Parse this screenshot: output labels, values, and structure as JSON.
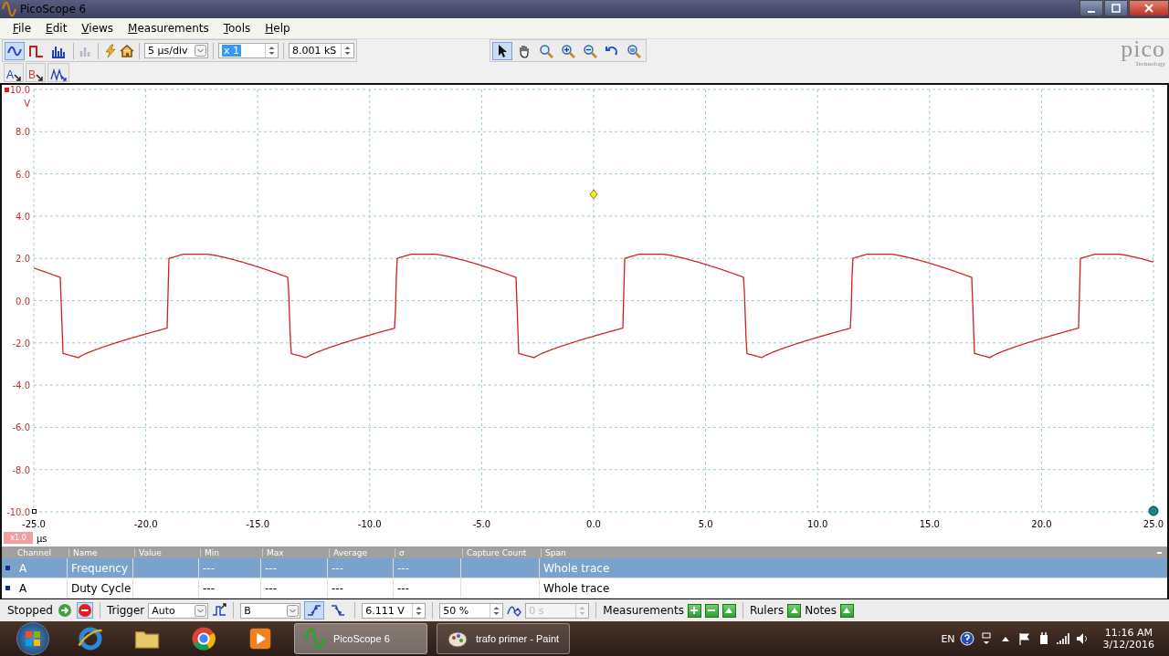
{
  "window": {
    "title": "PicoScope 6"
  },
  "menu": [
    "File",
    "Edit",
    "Views",
    "Measurements",
    "Tools",
    "Help"
  ],
  "modes": [
    {
      "kind": "scope",
      "selected": true
    },
    {
      "kind": "persistence",
      "selected": false
    },
    {
      "kind": "spectrum",
      "selected": false
    }
  ],
  "timebase": "5 µs/div",
  "zoom_field": "x 1",
  "samples": "8.001 kS",
  "tools": [
    {
      "kind": "pointer",
      "selected": true
    },
    {
      "kind": "hand",
      "selected": false
    },
    {
      "kind": "zoom-area",
      "selected": false
    },
    {
      "kind": "zoom-in",
      "selected": false
    },
    {
      "kind": "zoom-out",
      "selected": false
    },
    {
      "kind": "undo",
      "selected": false
    },
    {
      "kind": "zoom-overview",
      "selected": false
    }
  ],
  "logo": {
    "name": "pico",
    "tagline": "Technology"
  },
  "channels": [
    {
      "label": "A",
      "color": "#2040c0"
    },
    {
      "label": "B",
      "color": "#d04040"
    }
  ],
  "y_axis": {
    "unit": "V",
    "ticks": [
      "10.0",
      "8.0",
      "6.0",
      "4.0",
      "2.0",
      "0.0",
      "-2.0",
      "-4.0",
      "-6.0",
      "-8.0",
      "-10.0"
    ]
  },
  "x_axis": {
    "unit": "µs",
    "scale": "x1.0",
    "ticks": [
      "-25.0",
      "-20.0",
      "-15.0",
      "-10.0",
      "-5.0",
      "0.0",
      "5.0",
      "10.0",
      "15.0",
      "20.0",
      "25.0"
    ]
  },
  "table": {
    "columns": [
      "Channel",
      "Name",
      "Value",
      "Min",
      "Max",
      "Average",
      "σ",
      "Capture Count",
      "Span"
    ],
    "rows": [
      {
        "selected": true,
        "cells": [
          "A",
          "Frequency",
          "",
          "---",
          "---",
          "---",
          "---",
          "",
          "Whole trace"
        ]
      },
      {
        "selected": false,
        "cells": [
          "A",
          "Duty Cycle",
          "",
          "---",
          "---",
          "---",
          "---",
          "",
          "Whole trace"
        ]
      }
    ]
  },
  "status": {
    "state": "Stopped",
    "trigger_label": "Trigger",
    "trigger_mode": "Auto",
    "source": "B",
    "level": "6.111 V",
    "pretrigger": "50 %",
    "delay": {
      "value": "0 s",
      "disabled": true
    },
    "measurements": "Measurements",
    "rulers": "Rulers",
    "notes": "Notes"
  },
  "taskbar": {
    "tasks": [
      {
        "label": "PicoScope 6",
        "selected": true
      },
      {
        "label": "trafo primer - Paint",
        "selected": false
      }
    ],
    "language": "EN",
    "time": "11:16 AM",
    "date": "3/12/2016"
  }
}
